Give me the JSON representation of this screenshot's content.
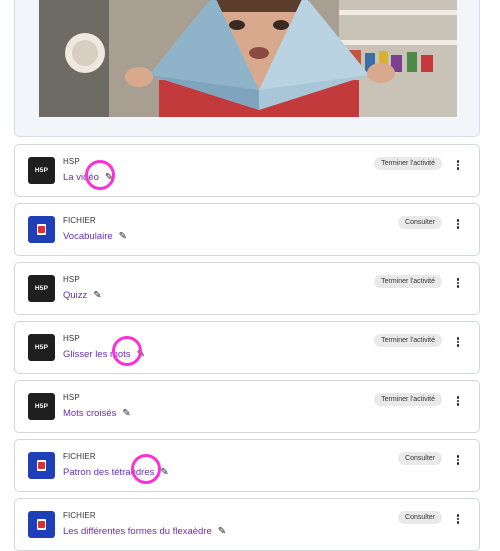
{
  "colors": {
    "link": "#6a2fb0",
    "hsp_icon_bg": "#1f1f1f",
    "file_icon_bg": "#1e3fb8",
    "badge_bg": "#e9e9e9",
    "highlight_ring": "#ff2fd6"
  },
  "icons": {
    "edit": "pencil-icon",
    "menu": "more-vertical-icon",
    "hsp": "hsp-logo-icon",
    "file": "file-icon"
  },
  "activities": [
    {
      "kind": "HSP",
      "name": "La vidéo",
      "status": "Terminer l'activité",
      "highlighted": true
    },
    {
      "kind": "FICHIER",
      "name": "Vocabulaire",
      "status": "Consulter",
      "highlighted": false
    },
    {
      "kind": "HSP",
      "name": "Quizz",
      "status": "Terminer l'activité",
      "highlighted": false
    },
    {
      "kind": "HSP",
      "name": "Glisser les mots",
      "status": "Terminer l'activité",
      "highlighted": true
    },
    {
      "kind": "HSP",
      "name": "Mots croisés",
      "status": "Terminer l'activité",
      "highlighted": false
    },
    {
      "kind": "FICHIER",
      "name": "Patron des tétraèdres",
      "status": "Consulter",
      "highlighted": true
    },
    {
      "kind": "FICHIER",
      "name": "Les différentes formes du flexaèdre",
      "status": "Consulter",
      "highlighted": false
    }
  ],
  "hsp_logo_text": "H5P"
}
